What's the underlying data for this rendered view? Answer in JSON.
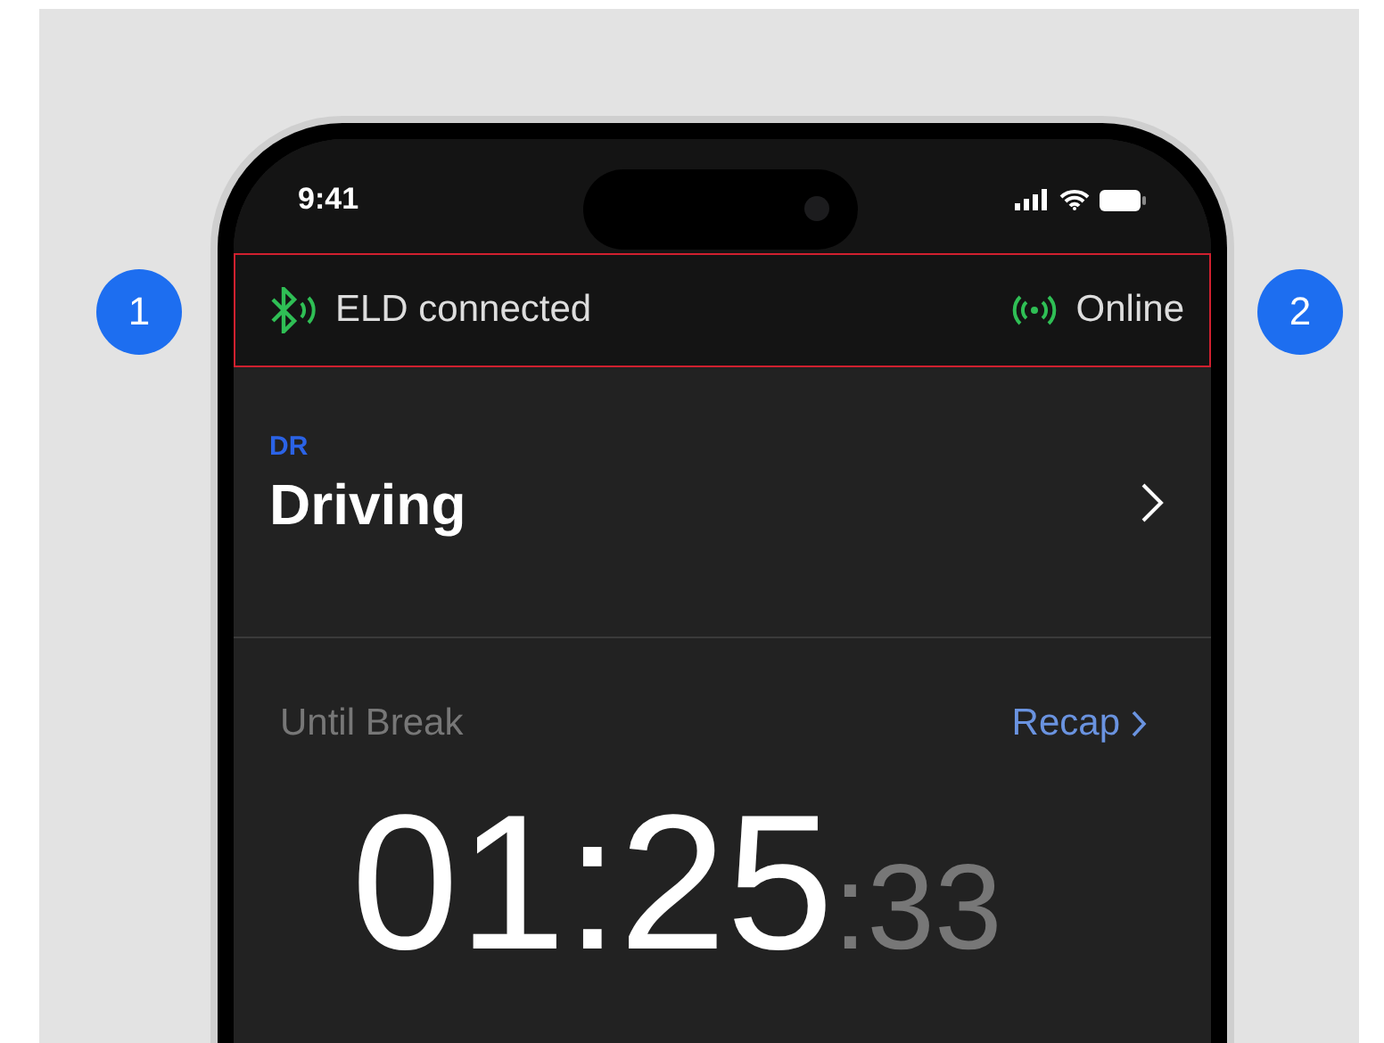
{
  "callouts": [
    "1",
    "2"
  ],
  "status_bar": {
    "time": "9:41"
  },
  "connection_bar": {
    "eld": "ELD connected",
    "network": "Online"
  },
  "duty_status": {
    "code": "DR",
    "label": "Driving"
  },
  "timer": {
    "label": "Until Break",
    "link": "Recap",
    "hours_minutes": "01:25",
    "seconds": ":33"
  }
}
